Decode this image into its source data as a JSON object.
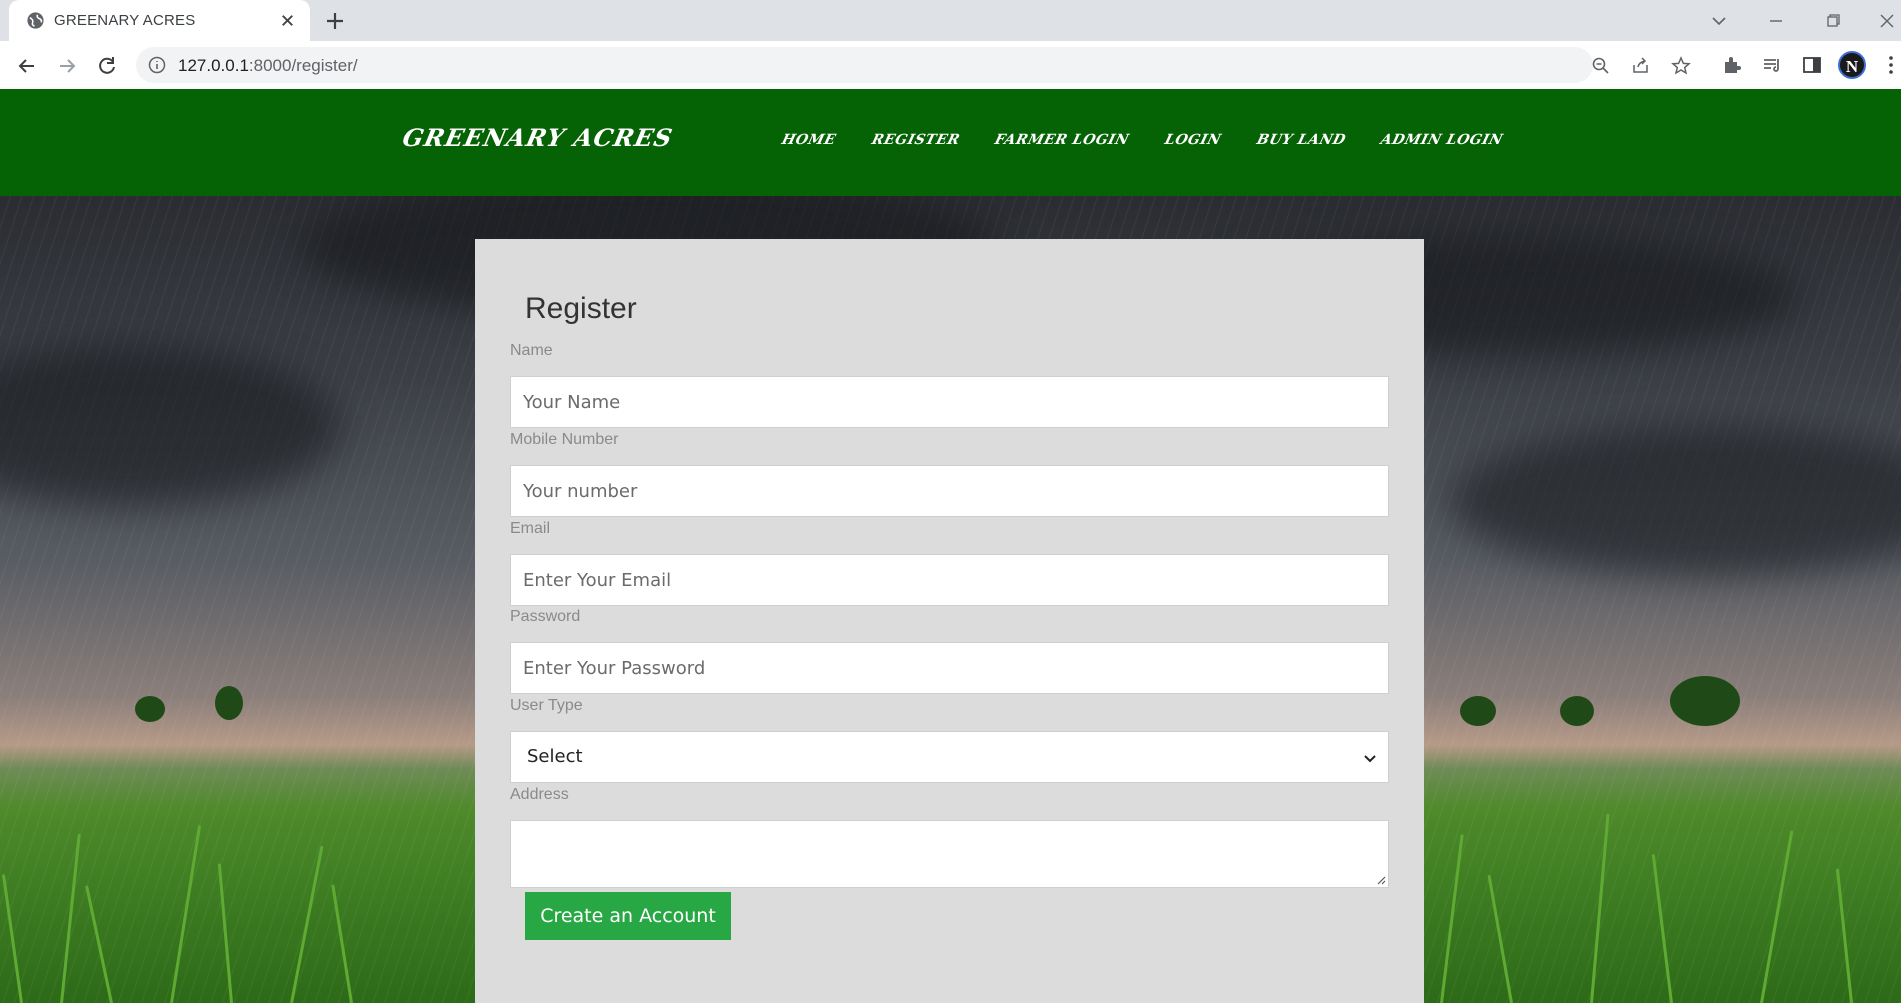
{
  "browser": {
    "tab_title": "GREENARY ACRES",
    "url_host": "127.0.0.1",
    "url_rest": ":8000/register/"
  },
  "site": {
    "brand": "GREENARY ACRES",
    "nav": [
      "HOME",
      "REGISTER",
      "FARMER LOGIN",
      "LOGIN",
      "BUY LAND",
      "ADMIN LOGIN"
    ]
  },
  "form": {
    "title": "Register",
    "name": {
      "label": "Name",
      "placeholder": "Your Name"
    },
    "mobile": {
      "label": "Mobile Number",
      "placeholder": "Your number"
    },
    "email": {
      "label": "Email",
      "placeholder": "Enter Your Email"
    },
    "password": {
      "label": "Password",
      "placeholder": "Enter Your Password"
    },
    "user_type": {
      "label": "User Type",
      "selected": "Select"
    },
    "address": {
      "label": "Address"
    },
    "submit_label": "Create an Account"
  },
  "colors": {
    "navbar": "#056205",
    "button": "#28a745",
    "card": "#dcdcdc"
  }
}
